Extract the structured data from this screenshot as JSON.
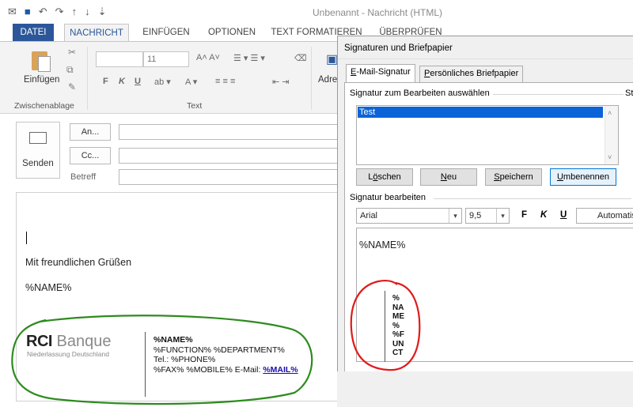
{
  "window": {
    "title": "Unbenannt - Nachricht (HTML)"
  },
  "quick_access": {
    "icons": [
      "mail-icon",
      "save-icon",
      "undo-icon",
      "redo-icon",
      "up-arrow-icon",
      "down-arrow-icon",
      "customize-icon"
    ]
  },
  "ribbon_tabs": [
    {
      "label": "DATEI"
    },
    {
      "label": "NACHRICHT"
    },
    {
      "label": "EINFÜGEN"
    },
    {
      "label": "OPTIONEN"
    },
    {
      "label": "TEXT FORMATIEREN"
    },
    {
      "label": "ÜBERPRÜFEN"
    }
  ],
  "ribbon": {
    "paste_label": "Einfügen",
    "clipboard_group": "Zwischenablage",
    "text_group": "Text",
    "font_size": "11",
    "bold": "F",
    "italic": "K",
    "underline": "U",
    "address_label": "Adre"
  },
  "message": {
    "send_label": "Senden",
    "to_label": "An...",
    "cc_label": "Cc...",
    "subject_label": "Betreff",
    "greeting": "Mit freundlichen Grüßen",
    "name_placeholder": "%NAME%",
    "logo": {
      "bold": "RCI",
      "light": "Banque",
      "subtitle": "Niederlassung Deutschland"
    },
    "signature_lines": {
      "name": "%NAME%",
      "function": "%FUNCTION% %DEPARTMENT%",
      "phone": "Tel.: %PHONE%",
      "fax_mobile": "%FAX% %MOBILE% E-Mail: ",
      "mail_link": "%MAIL%"
    }
  },
  "dialog": {
    "title": "Signaturen und Briefpapier",
    "tabs": {
      "email_signature": {
        "accel": "E",
        "rest": "-Mail-Signatur"
      },
      "stationery": {
        "accel": "P",
        "rest": "ersönliches Briefpapier"
      }
    },
    "select_label": "Signatur zum Bearbeiten auswählen",
    "side_label": "St",
    "signatures": [
      "Test"
    ],
    "buttons": {
      "delete": {
        "accel": "ö",
        "pre": "L",
        "post": "schen"
      },
      "new": {
        "accel": "N",
        "pre": "",
        "post": "eu"
      },
      "save": {
        "accel": "S",
        "pre": "",
        "post": "peichern"
      },
      "rename": {
        "accel": "U",
        "pre": "",
        "post": "mbenennen"
      }
    },
    "edit_label": "Signatur bearbeiten",
    "font": "Arial",
    "size": "9,5",
    "bold": "F",
    "italic": "K",
    "underline": "U",
    "auto_label": "Automatis",
    "editor_name": "%NAME%",
    "wrapped_text": [
      "%",
      "NA",
      "ME",
      "%",
      "%F",
      "UN",
      "CT"
    ]
  },
  "annotation_colors": {
    "green": "#2e8b1f",
    "red": "#e01b1b"
  }
}
